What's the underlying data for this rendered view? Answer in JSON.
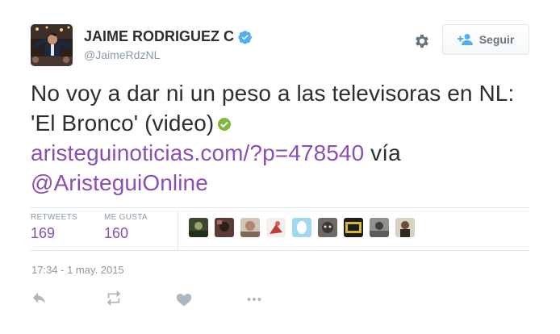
{
  "author": {
    "full_name": "JAIME RODRIGUEZ C",
    "screen_name": "@JaimeRdzNL",
    "verified": true
  },
  "follow_button": {
    "label": "Seguir"
  },
  "tweet": {
    "text_before_link": "No voy a dar ni un peso a las televisoras en NL: 'El Bronco' (video)",
    "link": "aristeguinoticias.com/?p=478540",
    "via_word": "vía",
    "mention": "@AristeguiOnline"
  },
  "stats": {
    "retweets_label": "RETWEETS",
    "retweets_count": "169",
    "likes_label": "ME GUSTA",
    "likes_count": "160"
  },
  "timestamp": "17:34 - 1 may. 2015",
  "colors": {
    "link": "#8a4fb5",
    "verified": "#55acee",
    "check": "#7fb93c",
    "muted": "#8899a6"
  },
  "icons": {
    "settings": "gear-icon",
    "follow": "person-plus-icon",
    "reply": "reply-icon",
    "retweet": "retweet-icon",
    "like": "heart-icon",
    "more": "more-icon"
  }
}
